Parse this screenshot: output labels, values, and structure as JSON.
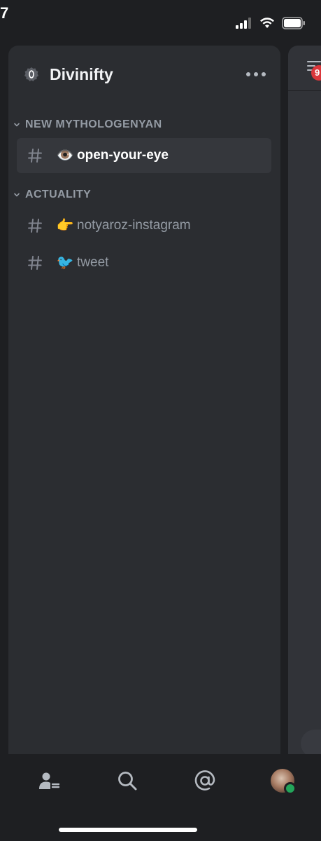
{
  "status_bar": {
    "time_fragment": "7",
    "icons": [
      "cellular-signal-icon",
      "wifi-icon",
      "battery-icon"
    ]
  },
  "server": {
    "name": "Divinifty",
    "icon": "server-icon",
    "menu_icon": "more-options-icon"
  },
  "categories": [
    {
      "label": "NEW MYTHOLOGENYAN",
      "collapsed": false,
      "channels": [
        {
          "emoji": "👁️",
          "name": "open-your-eye",
          "selected": true
        }
      ]
    },
    {
      "label": "ACTUALITY",
      "collapsed": false,
      "channels": [
        {
          "emoji": "👉",
          "name": "notyaroz-instagram",
          "selected": false
        },
        {
          "emoji": "🐦",
          "name": "tweet",
          "selected": false
        }
      ]
    }
  ],
  "peek_panel": {
    "icon": "threads-icon",
    "badge": "9"
  },
  "bottom_nav": {
    "items": [
      "friends-icon",
      "search-icon",
      "mentions-icon",
      "profile-avatar"
    ],
    "presence": "online"
  },
  "colors": {
    "background": "#1e1f22",
    "panel": "#2b2d31",
    "selected_channel": "#35373c",
    "muted_text": "#949ba4",
    "online": "#23a55a",
    "badge": "#da373c"
  }
}
